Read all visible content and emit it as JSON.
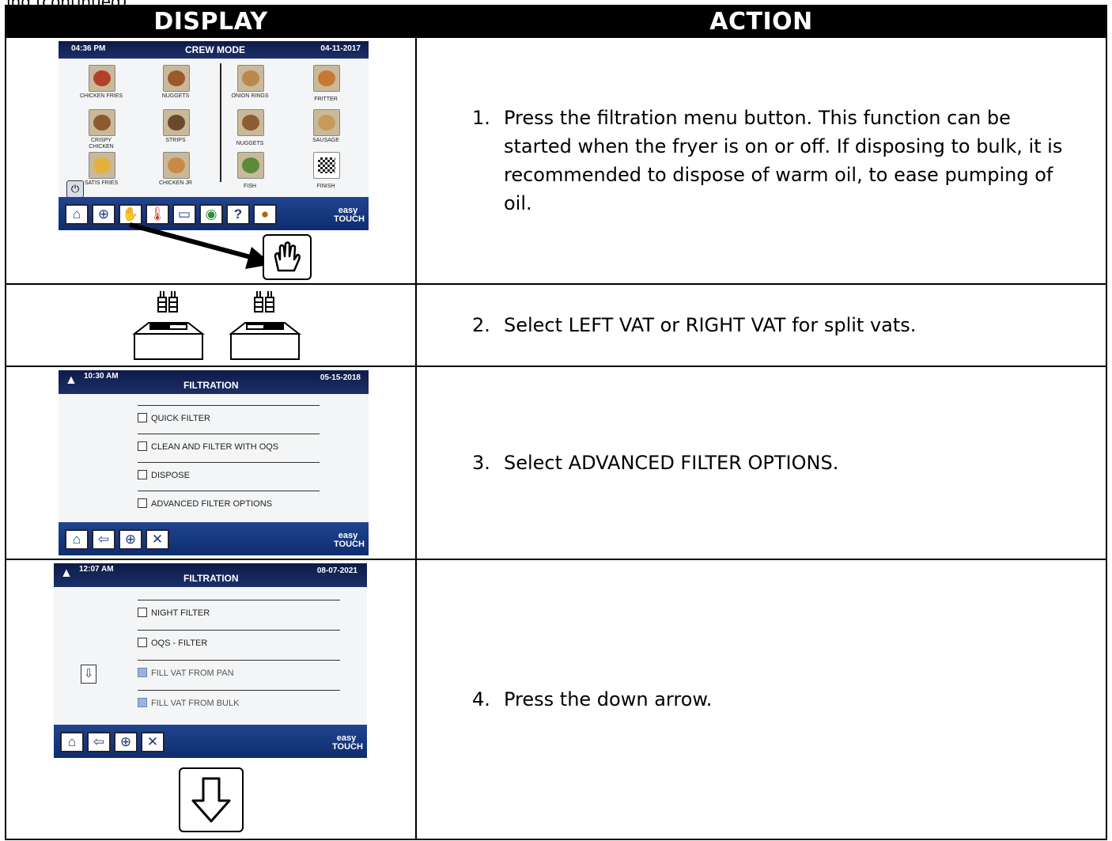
{
  "header": {
    "display": "DISPLAY",
    "action": "ACTION"
  },
  "top_cut_text": "ing (continued)",
  "rows": [
    {
      "number": "1.",
      "text": "Press the filtration menu button. This function can be started when the fryer is on or off.  If disposing to bulk, it is recommended to dispose of warm oil, to ease pumping of oil."
    },
    {
      "number": "2.",
      "text": "Select LEFT VAT or RIGHT VAT for split vats."
    },
    {
      "number": "3.",
      "text": "Select ADVANCED FILTER OPTIONS."
    },
    {
      "number": "4.",
      "text": "Press the down arrow."
    }
  ],
  "screen1": {
    "time": "04:36 PM",
    "title": "CREW MODE",
    "date": "04-11-2017",
    "items": [
      "CHICKEN FRIES",
      "NUGGETS",
      "ONION RINGS",
      "FRITTER",
      "CRISPY CHICKEN",
      "STRIPS",
      "NUGGETS",
      "SAUSAGE",
      "SATIS FRIES",
      "CHICKEN JR",
      "FISH",
      "FINISH"
    ],
    "logo": "easy TOUCH",
    "help_glyph": "?"
  },
  "screen2": {
    "time": "10:30 AM",
    "title": "FILTRATION",
    "date": "05-15-2018",
    "options": [
      "QUICK FILTER",
      "CLEAN AND FILTER WITH OQS",
      "DISPOSE",
      "ADVANCED FILTER OPTIONS"
    ],
    "logo": "easy TOUCH"
  },
  "screen3": {
    "time": "12:07 AM",
    "title": "FILTRATION",
    "date": "08-07-2021",
    "options": [
      "NIGHT FILTER",
      "OQS - FILTER",
      "FILL VAT FROM PAN",
      "FILL VAT FROM BULK"
    ],
    "logo": "easy TOUCH"
  },
  "colors": {
    "header_bg": "#000000",
    "screen_bar": "#1b3a7e",
    "screen_header": "#0c1b46"
  }
}
